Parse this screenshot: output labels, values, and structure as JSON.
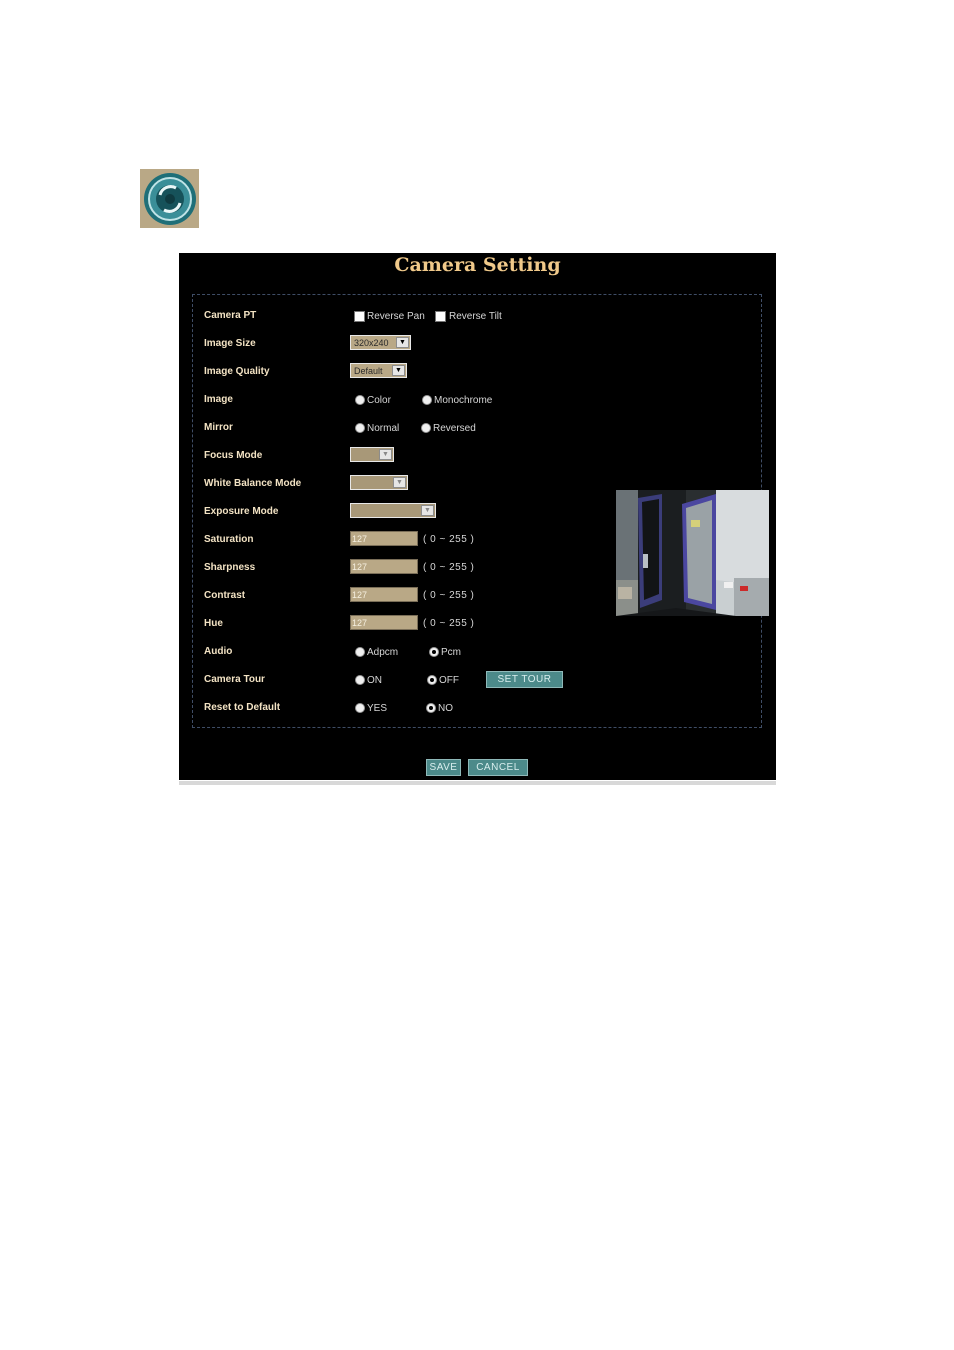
{
  "panel": {
    "title": "Camera Setting"
  },
  "rows": {
    "camera_pt": {
      "label": "Camera PT",
      "reverse_pan": "Reverse Pan",
      "reverse_tilt": "Reverse Tilt"
    },
    "image_size": {
      "label": "Image Size",
      "value": "320x240"
    },
    "image_quality": {
      "label": "Image Quality",
      "value": "Default"
    },
    "image": {
      "label": "Image",
      "option_color": "Color",
      "option_mono": "Monochrome"
    },
    "mirror": {
      "label": "Mirror",
      "option_normal": "Normal",
      "option_reversed": "Reversed"
    },
    "focus_mode": {
      "label": "Focus Mode",
      "value": ""
    },
    "white_balance": {
      "label": "White Balance Mode",
      "value": ""
    },
    "exposure_mode": {
      "label": "Exposure Mode",
      "value": ""
    },
    "saturation": {
      "label": "Saturation",
      "value": "127",
      "range": "( 0 ~ 255 )"
    },
    "sharpness": {
      "label": "Sharpness",
      "value": "127",
      "range": "( 0 ~ 255 )"
    },
    "contrast": {
      "label": "Contrast",
      "value": "127",
      "range": "( 0 ~ 255 )"
    },
    "hue": {
      "label": "Hue",
      "value": "127",
      "range": "( 0 ~ 255 )"
    },
    "audio": {
      "label": "Audio",
      "option_adpcm": "Adpcm",
      "option_pcm": "Pcm",
      "selected": "Pcm"
    },
    "camera_tour": {
      "label": "Camera Tour",
      "option_on": "ON",
      "option_off": "OFF",
      "selected": "OFF",
      "set_tour": "SET TOUR"
    },
    "reset": {
      "label": "Reset to Default",
      "option_yes": "YES",
      "option_no": "NO",
      "selected": "NO"
    }
  },
  "buttons": {
    "save": "SAVE",
    "cancel": "CANCEL"
  },
  "colors": {
    "panel_bg": "#000000",
    "title": "#f0c98a",
    "field_bg": "#b9a886",
    "button": "#4c8a8a"
  },
  "icons": {
    "app_icon": "camera-setting-icon"
  }
}
